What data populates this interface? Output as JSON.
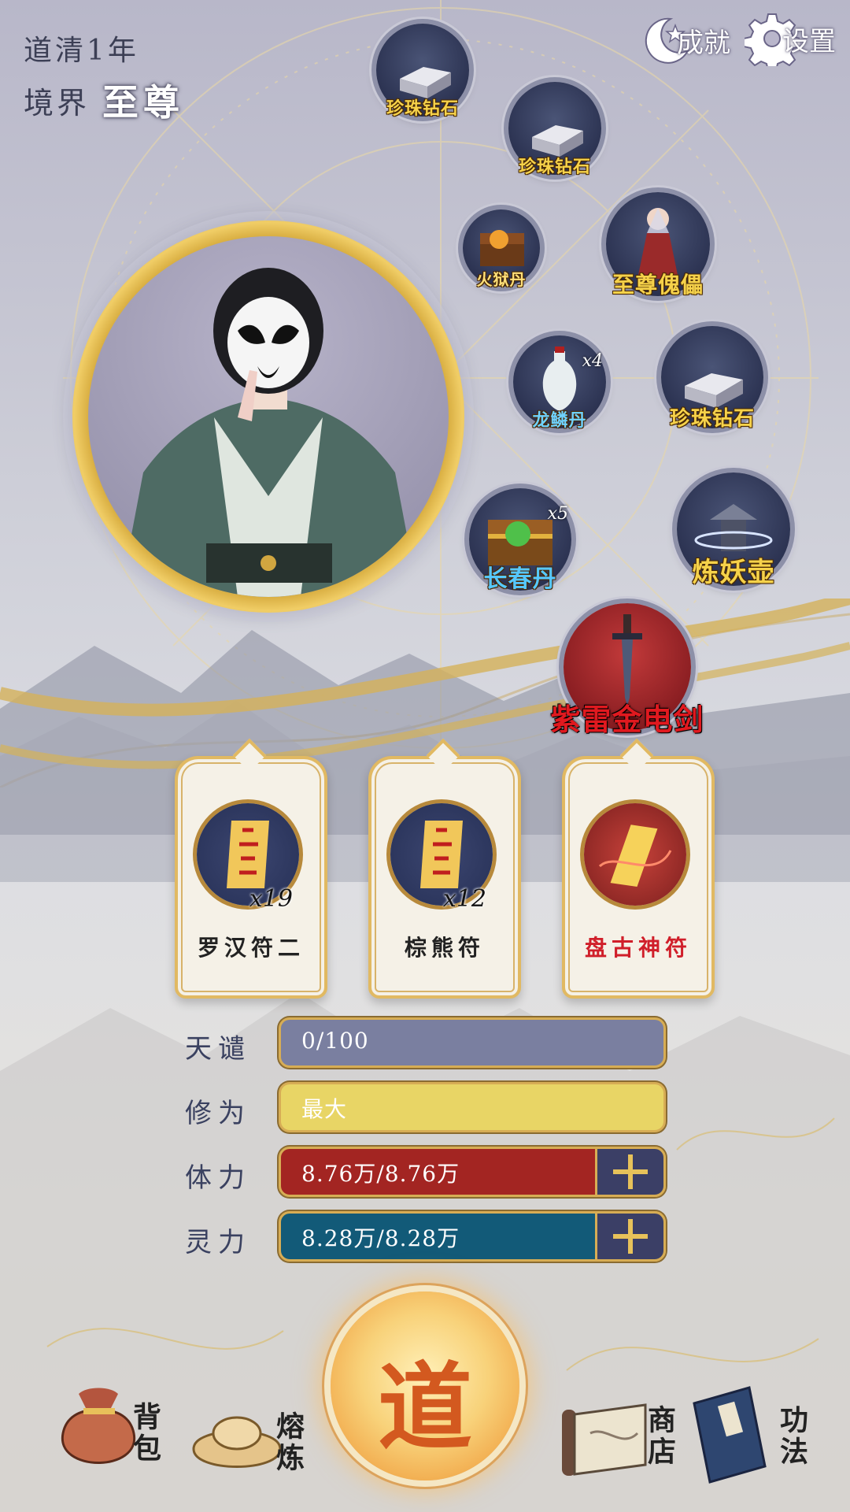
{
  "status": {
    "year_text": "道清1年",
    "realm_label": "境界",
    "realm_value": "至尊"
  },
  "top_buttons": {
    "achievement": "成就",
    "settings": "设置"
  },
  "items": [
    {
      "name": "珍珠钻石",
      "count": ""
    },
    {
      "name": "珍珠钻石",
      "count": ""
    },
    {
      "name": "火狱丹",
      "count": ""
    },
    {
      "name": "至尊傀儡",
      "count": ""
    },
    {
      "name": "龙鳞丹",
      "count": "x4"
    },
    {
      "name": "珍珠钻石",
      "count": ""
    },
    {
      "name": "长春丹",
      "count": "x5"
    },
    {
      "name": "炼妖壶",
      "count": ""
    },
    {
      "name": "紫雷金电剑",
      "count": ""
    }
  ],
  "talismans": [
    {
      "name": "罗汉符二",
      "count": "x19"
    },
    {
      "name": "棕熊符",
      "count": "x12"
    },
    {
      "name": "盘古神符",
      "count": ""
    }
  ],
  "stats": {
    "tianqian": {
      "label": "天谴",
      "value": "0/100",
      "fraction": 0
    },
    "xiuwei": {
      "label": "修为",
      "value": "最大",
      "fraction": 1
    },
    "tili": {
      "label": "体力",
      "value": "8.76万/8.76万",
      "fraction": 1
    },
    "lingli": {
      "label": "灵力",
      "value": "8.28万/8.28万",
      "fraction": 1
    }
  },
  "bottom_nav": {
    "bag": "背包",
    "smelt": "熔炼",
    "dao": "道",
    "shop": "商店",
    "skills": "功法"
  },
  "colors": {
    "tianqian_bar": "#7a7fa0",
    "xiuwei_bar": "#e8d565",
    "tili_bar": "#a32522",
    "lingli_bar": "#125a78",
    "gold_label": "#f6d24a",
    "red_label": "#e0191f"
  }
}
